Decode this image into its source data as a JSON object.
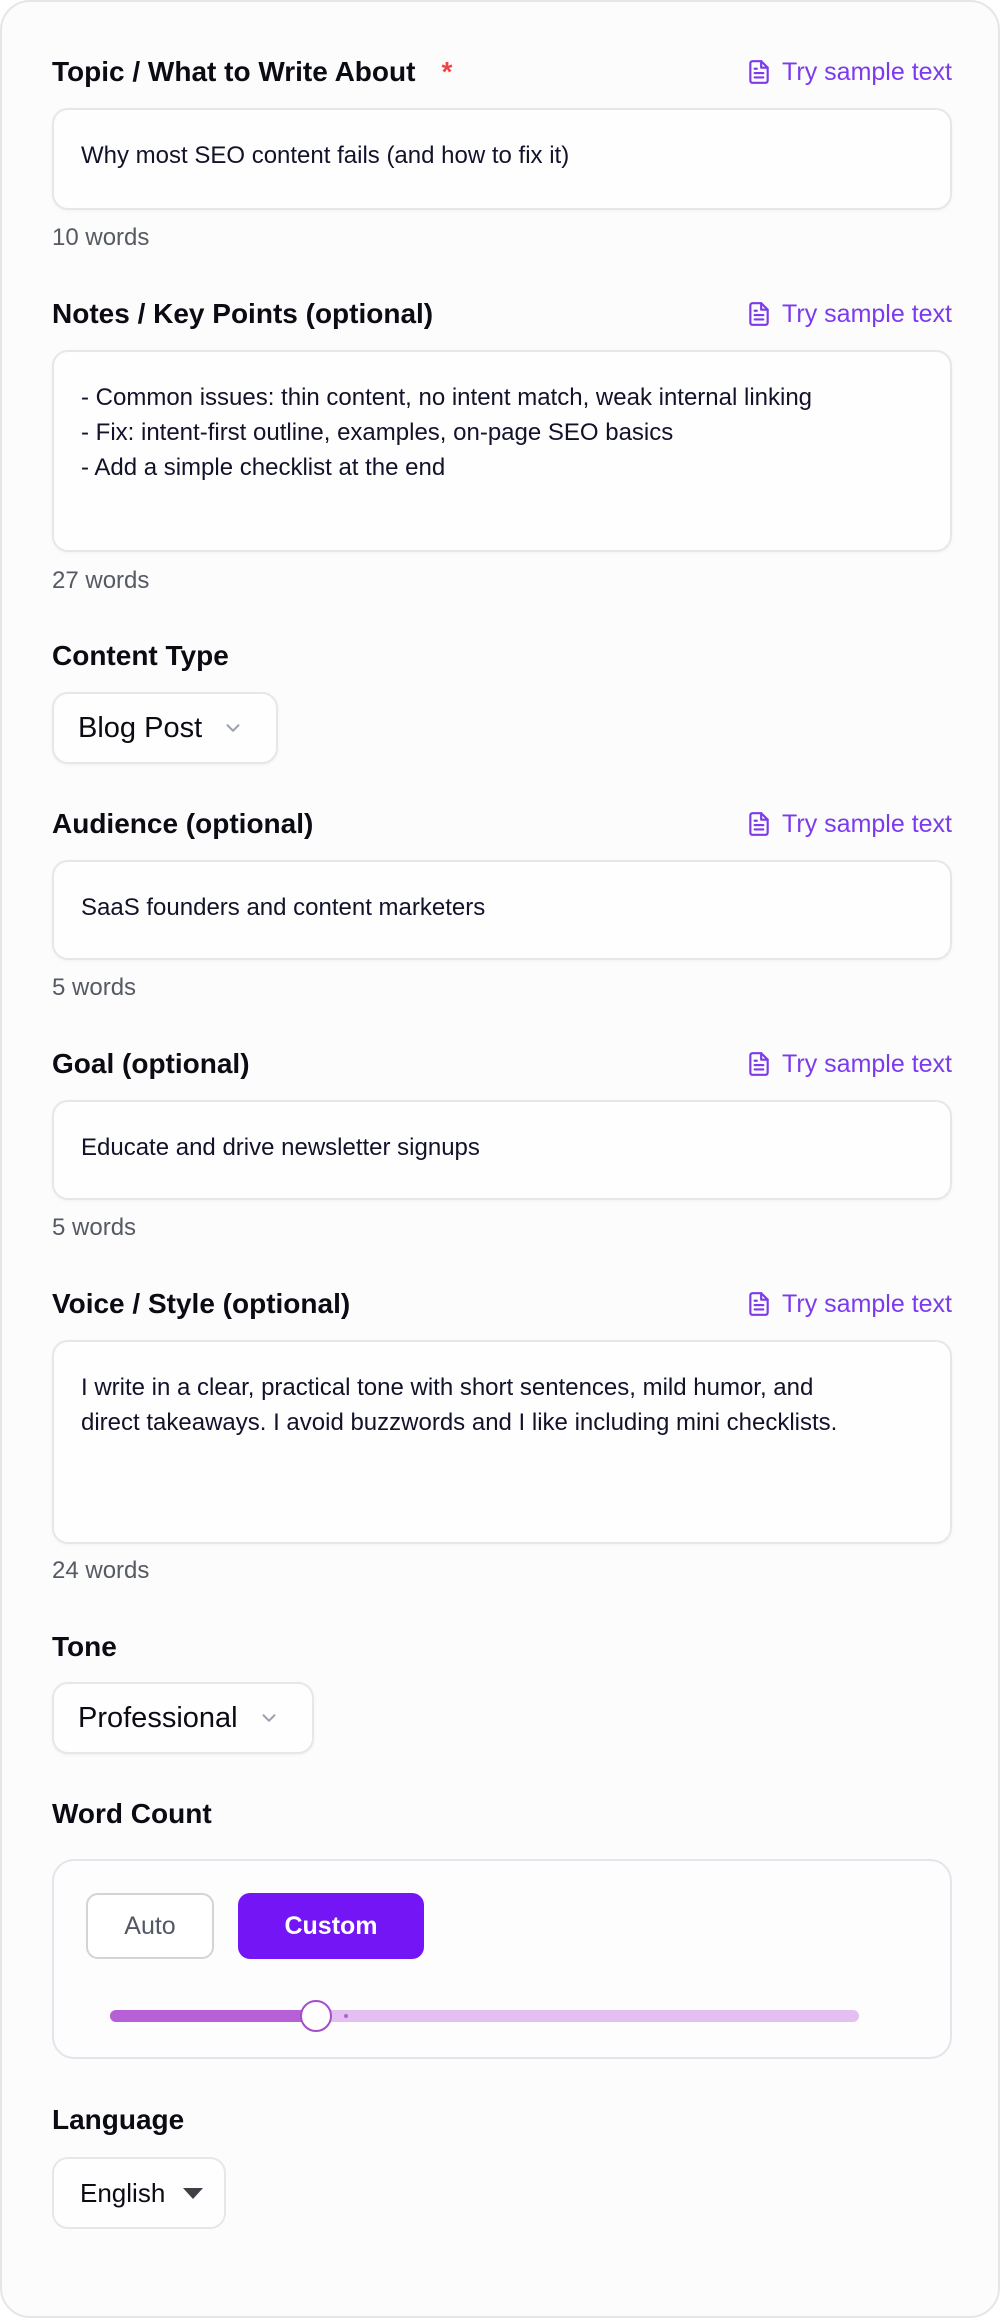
{
  "sample_button_label": "Try sample text",
  "topic": {
    "label": "Topic / What to Write About",
    "required_mark": "*",
    "value": "Why most SEO content fails (and how to fix it)",
    "word_count": "10 words"
  },
  "notes": {
    "label": "Notes / Key Points (optional)",
    "value": "- Common issues: thin content, no intent match, weak internal linking\n- Fix: intent-first outline, examples, on-page SEO basics\n- Add a simple checklist at the end",
    "word_count": "27 words"
  },
  "content_type": {
    "label": "Content Type",
    "selected": "Blog Post"
  },
  "audience": {
    "label": "Audience (optional)",
    "value": "SaaS founders and content marketers",
    "word_count": "5 words"
  },
  "goal": {
    "label": "Goal (optional)",
    "value": "Educate and drive newsletter signups",
    "word_count": "5 words"
  },
  "voice": {
    "label": "Voice / Style (optional)",
    "value": "I write in a clear, practical tone with short sentences, mild humor, and\ndirect takeaways. I avoid buzzwords and I like including mini checklists.",
    "word_count": "24 words"
  },
  "tone": {
    "label": "Tone",
    "selected": "Professional"
  },
  "word_count_setting": {
    "label": "Word Count",
    "auto_label": "Auto",
    "custom_label": "Custom",
    "selected_mode": "Custom",
    "slider_fraction": 0.275
  },
  "language": {
    "label": "Language",
    "selected": "English"
  },
  "colors": {
    "accent": "#7415f5",
    "link": "#7c3aed",
    "required": "#ef4444",
    "slider_fill": "#b65fd6",
    "slider_track": "#e3c0ef"
  },
  "icons": {
    "sample": "document-icon",
    "dropdown": "chevron-down-icon",
    "language_dropdown": "caret-down-icon"
  }
}
